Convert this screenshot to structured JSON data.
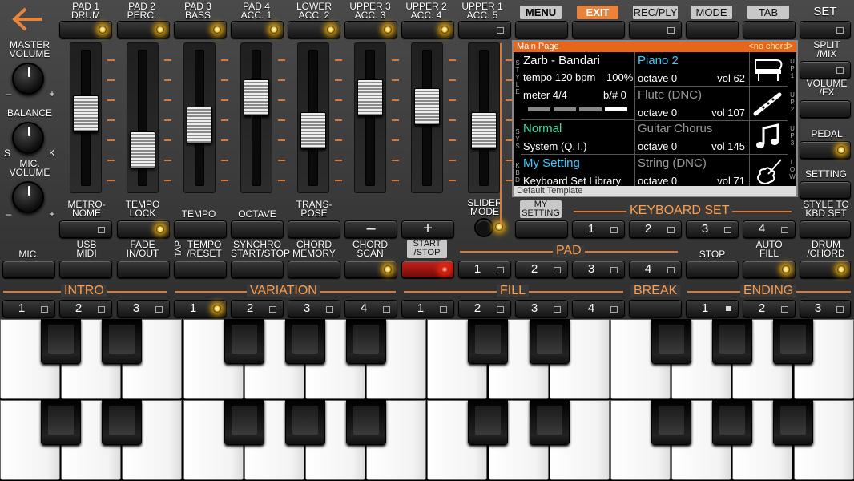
{
  "topbar": {
    "back_icon": "back-arrow-icon",
    "pad_labels": [
      [
        "PAD 1",
        "DRUM"
      ],
      [
        "PAD 2",
        "PERC."
      ],
      [
        "PAD 3",
        "BASS"
      ],
      [
        "PAD 4",
        "ACC. 1"
      ],
      [
        "LOWER",
        "ACC. 2"
      ],
      [
        "UPPER 3",
        "ACC. 3"
      ],
      [
        "UPPER 2",
        "ACC. 4"
      ],
      [
        "UPPER 1",
        "ACC. 5"
      ]
    ],
    "menu": [
      "MENU",
      "EXIT",
      "REC/PLY",
      "MODE",
      "TAB"
    ],
    "set": "SET"
  },
  "left_controls": {
    "master_volume": [
      "MASTER",
      "VOLUME"
    ],
    "balance": "BALANCE",
    "mic_volume": [
      "MIC.",
      "VOLUME"
    ],
    "minus": "–",
    "plus": "+",
    "s": "S",
    "k": "K"
  },
  "sliders": {
    "slider_mode": [
      "SLIDER",
      "MODE"
    ],
    "levels": [
      0.55,
      0.22,
      0.45,
      0.7,
      0.4,
      0.7,
      0.62,
      0.4
    ]
  },
  "lcd": {
    "header": "Main Page",
    "chord": "<no chord>",
    "style_name": "Zarb - Bandari",
    "tempo": "tempo 120 bpm",
    "percent": "100%",
    "meter": "meter 4/4",
    "bflat": "b/# 0",
    "sys_name": "Normal",
    "sys_sub": "System (Q.T.)",
    "kbd_name": "My Setting",
    "kbd_sub": "Keyboard Set Library",
    "footer": "Default Template",
    "side_style": "STYLE",
    "side_sys": "SYS",
    "side_kbd": "KBD",
    "up1": "UP1",
    "up2": "UP2",
    "up3": "UP3",
    "low": "LOW",
    "parts": [
      {
        "name": "Piano 2",
        "octave": "octave 0",
        "vol": "vol 62",
        "icon": "piano-icon"
      },
      {
        "name": "Flute (DNC)",
        "octave": "octave 0",
        "vol": "vol 107",
        "icon": "flute-icon"
      },
      {
        "name": "Guitar Chorus",
        "octave": "octave 0",
        "vol": "vol 145",
        "icon": "music-note-icon"
      },
      {
        "name": "String (DNC)",
        "octave": "octave 0",
        "vol": "vol 71",
        "icon": "violin-icon"
      }
    ],
    "colors": {
      "header": "#e8651c",
      "style": "#ffffff",
      "sys": "#38e0a0",
      "kbd": "#40c8ff",
      "part": "#40c8ff"
    }
  },
  "right_controls": {
    "split_mix": [
      "SPLIT",
      "/MIX"
    ],
    "volume_fx": [
      "VOLUME",
      "/FX"
    ],
    "pedal": "PEDAL",
    "setting": "SETTING",
    "style_to_kbd": [
      "STYLE TO",
      "KBD SET"
    ],
    "drum_chord": [
      "DRUM",
      "/CHORD"
    ]
  },
  "row1": {
    "metronome": [
      "METRO-",
      "NOME"
    ],
    "tempo_lock": [
      "TEMPO",
      "LOCK"
    ],
    "tempo": "TEMPO",
    "octave": "OCTAVE",
    "transpose": [
      "TRANS-",
      "POSE"
    ],
    "minus": "–",
    "plus": "+",
    "my_setting": [
      "MY",
      "SETTING"
    ],
    "keyboard_set": "KEYBOARD SET",
    "kbd_nums": [
      "1",
      "2",
      "3",
      "4"
    ]
  },
  "row2": {
    "mic": "MIC.",
    "usb_midi": [
      "USB",
      "MIDI"
    ],
    "fade": [
      "FADE",
      "IN/OUT"
    ],
    "tap": "TAP",
    "tempo_reset": [
      "TEMPO",
      "/RESET"
    ],
    "synchro": [
      "SYNCHRO",
      "START/STOP"
    ],
    "chord_memory": [
      "CHORD",
      "MEMORY"
    ],
    "chord_scan": [
      "CHORD",
      "SCAN"
    ],
    "start_stop": [
      "START",
      "/STOP"
    ],
    "pad": "PAD",
    "pad_nums": [
      "1",
      "2",
      "3",
      "4"
    ],
    "stop": "STOP",
    "auto_fill": [
      "AUTO",
      "FILL"
    ]
  },
  "row3": {
    "intro": "INTRO",
    "variation": "VARIATION",
    "fill": "FILL",
    "break": "BREAK",
    "ending": "ENDING",
    "intro_nums": [
      "1",
      "2",
      "3"
    ],
    "variation_nums": [
      "1",
      "2",
      "3",
      "4"
    ],
    "fill_nums": [
      "1",
      "2",
      "3",
      "4"
    ],
    "ending_nums": [
      "1",
      "2",
      "3"
    ]
  }
}
